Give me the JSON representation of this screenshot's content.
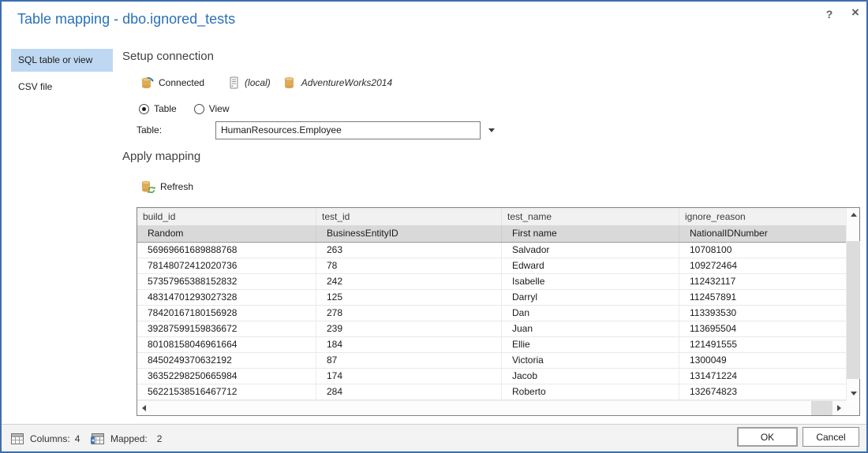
{
  "dialog": {
    "title": "Table mapping - dbo.ignored_tests",
    "help": "?",
    "close": "×"
  },
  "sidebar": {
    "items": [
      {
        "label": "SQL table or view",
        "selected": true
      },
      {
        "label": "CSV file",
        "selected": false
      }
    ]
  },
  "connection": {
    "heading": "Setup connection",
    "connected_label": "Connected",
    "server_name": "(local)",
    "database_name": "AdventureWorks2014",
    "table_radio": "Table",
    "view_radio": "View",
    "table_field_label": "Table:",
    "table_field_value": "HumanResources.Employee"
  },
  "mapping": {
    "heading": "Apply mapping",
    "refresh_label": "Refresh"
  },
  "grid": {
    "columns": [
      "build_id",
      "test_id",
      "test_name",
      "ignore_reason"
    ],
    "mapping_row": [
      "Random",
      "BusinessEntityID",
      "First name",
      "NationalIDNumber"
    ],
    "rows": [
      [
        "56969661689888768",
        "263",
        "Salvador",
        "10708100"
      ],
      [
        "78148072412020736",
        "78",
        "Edward",
        "109272464"
      ],
      [
        "57357965388152832",
        "242",
        "Isabelle",
        "112432117"
      ],
      [
        "48314701293027328",
        "125",
        "Darryl",
        "112457891"
      ],
      [
        "78420167180156928",
        "278",
        "Dan",
        "113393530"
      ],
      [
        "39287599159836672",
        "239",
        "Juan",
        "113695504"
      ],
      [
        "80108158046961664",
        "184",
        "Ellie",
        "121491555"
      ],
      [
        "8450249370632192",
        "87",
        "Victoria",
        "1300049"
      ],
      [
        "36352298250665984",
        "174",
        "Jacob",
        "131471224"
      ],
      [
        "56221538516467712",
        "284",
        "Roberto",
        "132674823"
      ]
    ]
  },
  "status_bar": {
    "columns_label": "Columns:",
    "columns_value": "4",
    "mapped_label": "Mapped:",
    "mapped_value": "2",
    "ok_label": "OK",
    "cancel_label": "Cancel"
  },
  "colors": {
    "dialog_border": "#3c6fad",
    "title_text": "#2b70b9",
    "selected_tab_bg": "#bed8f2",
    "grid_header_bg": "#f1f1f1",
    "grid_mapping_row_bg": "#d9d9d9",
    "database_icon": "#dfab57",
    "refresh_arrow_green": "#44a048",
    "connected_arrow_blue": "#2e75b5"
  }
}
